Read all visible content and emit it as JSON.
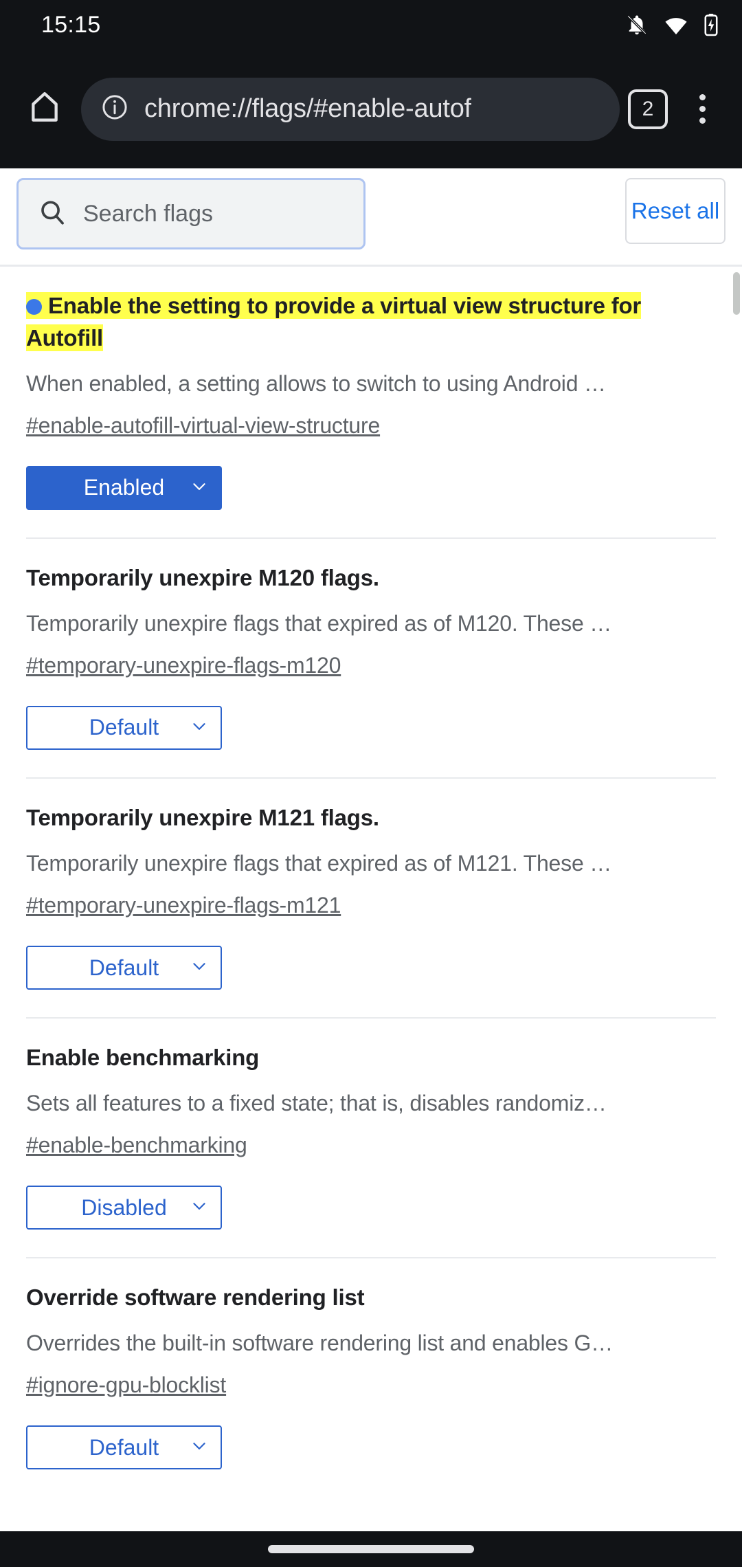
{
  "status_bar": {
    "time": "15:15",
    "icons": [
      "notifications-off-icon",
      "wifi-icon",
      "battery-charging-icon"
    ]
  },
  "toolbar": {
    "home_icon": "home-icon",
    "info_icon": "info-circle-icon",
    "url": "chrome://flags/#enable-autof",
    "tab_count": "2",
    "menu_icon": "more-vertical-icon"
  },
  "search": {
    "icon": "search-icon",
    "placeholder": "Search flags",
    "value": "",
    "reset_label": "Reset all"
  },
  "flags": [
    {
      "title": "Enable the setting to provide a virtual view structure for Autofill",
      "highlighted": true,
      "has_dot": true,
      "description": "When enabled, a setting allows to switch to using Android …",
      "link": "#enable-autofill-virtual-view-structure",
      "select_value": "Enabled",
      "select_state": "enabled"
    },
    {
      "title": "Temporarily unexpire M120 flags.",
      "highlighted": false,
      "has_dot": false,
      "description": "Temporarily unexpire flags that expired as of M120. These …",
      "link": "#temporary-unexpire-flags-m120",
      "select_value": "Default",
      "select_state": "plain"
    },
    {
      "title": "Temporarily unexpire M121 flags.",
      "highlighted": false,
      "has_dot": false,
      "description": "Temporarily unexpire flags that expired as of M121. These …",
      "link": "#temporary-unexpire-flags-m121",
      "select_value": "Default",
      "select_state": "plain"
    },
    {
      "title": "Enable benchmarking",
      "highlighted": false,
      "has_dot": false,
      "description": "Sets all features to a fixed state; that is, disables randomiz…",
      "link": "#enable-benchmarking",
      "select_value": "Disabled",
      "select_state": "plain"
    },
    {
      "title": "Override software rendering list",
      "highlighted": false,
      "has_dot": false,
      "description": "Overrides the built-in software rendering list and enables G…",
      "link": "#ignore-gpu-blocklist",
      "select_value": "Default",
      "select_state": "plain"
    }
  ],
  "colors": {
    "highlight": "#ffff4d",
    "accent_blue": "#2c63cc",
    "link_blue": "#1a73e8",
    "dot_blue": "#3b78e7",
    "chrome_dark": "#111316"
  },
  "nav_bar": {
    "pill": "home-gesture-pill"
  }
}
